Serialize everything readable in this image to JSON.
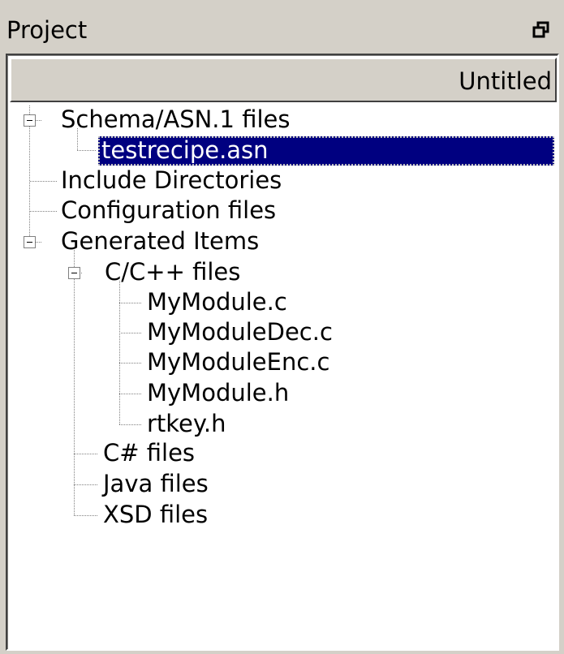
{
  "dock": {
    "title": "Project",
    "float_icon": "float-restore-icon"
  },
  "column_header": "Untitled",
  "tree": {
    "schema": {
      "label": "Schema/ASN.1 files",
      "expanded": true
    },
    "schema_file": {
      "label": "testrecipe.asn",
      "selected": true
    },
    "include_dirs": {
      "label": "Include Directories"
    },
    "config_files": {
      "label": "Configuration files"
    },
    "generated": {
      "label": "Generated Items",
      "expanded": true
    },
    "cpp": {
      "label": "C/C++ files",
      "expanded": true
    },
    "cpp_files": [
      "MyModule.c",
      "MyModuleDec.c",
      "MyModuleEnc.c",
      "MyModule.h",
      "rtkey.h"
    ],
    "csharp": {
      "label": "C# files"
    },
    "java": {
      "label": "Java files"
    },
    "xsd": {
      "label": "XSD files"
    }
  },
  "colors": {
    "selection": "#000080",
    "chrome": "#d4d0c8"
  }
}
